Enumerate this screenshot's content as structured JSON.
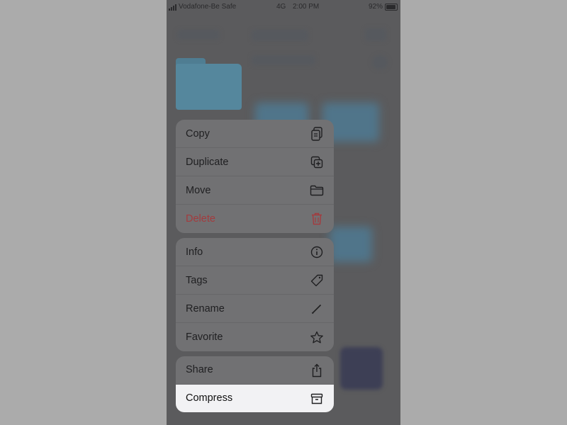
{
  "status_bar": {
    "carrier": "Vodafone-Be Safe",
    "network": "4G",
    "time": "2:00 PM",
    "battery": "92%",
    "battery_level": 0.92
  },
  "menu": {
    "groups": [
      {
        "items": [
          {
            "label": "Copy",
            "icon": "copy-icon"
          },
          {
            "label": "Duplicate",
            "icon": "duplicate-icon"
          },
          {
            "label": "Move",
            "icon": "folder-icon"
          },
          {
            "label": "Delete",
            "icon": "trash-icon"
          }
        ]
      },
      {
        "items": [
          {
            "label": "Info",
            "icon": "info-icon"
          },
          {
            "label": "Tags",
            "icon": "tag-icon"
          },
          {
            "label": "Rename",
            "icon": "pencil-icon"
          },
          {
            "label": "Favorite",
            "icon": "star-icon"
          }
        ]
      },
      {
        "items": [
          {
            "label": "Share",
            "icon": "share-icon"
          },
          {
            "label": "Compress",
            "icon": "archive-icon"
          }
        ]
      }
    ]
  },
  "colors": {
    "backdrop": "#ababab",
    "screen": "#5b5b5d",
    "menu_background": "#717173",
    "highlight": "#f2f2f4",
    "destructive": "#a33b3e",
    "folder": "#55879d"
  }
}
